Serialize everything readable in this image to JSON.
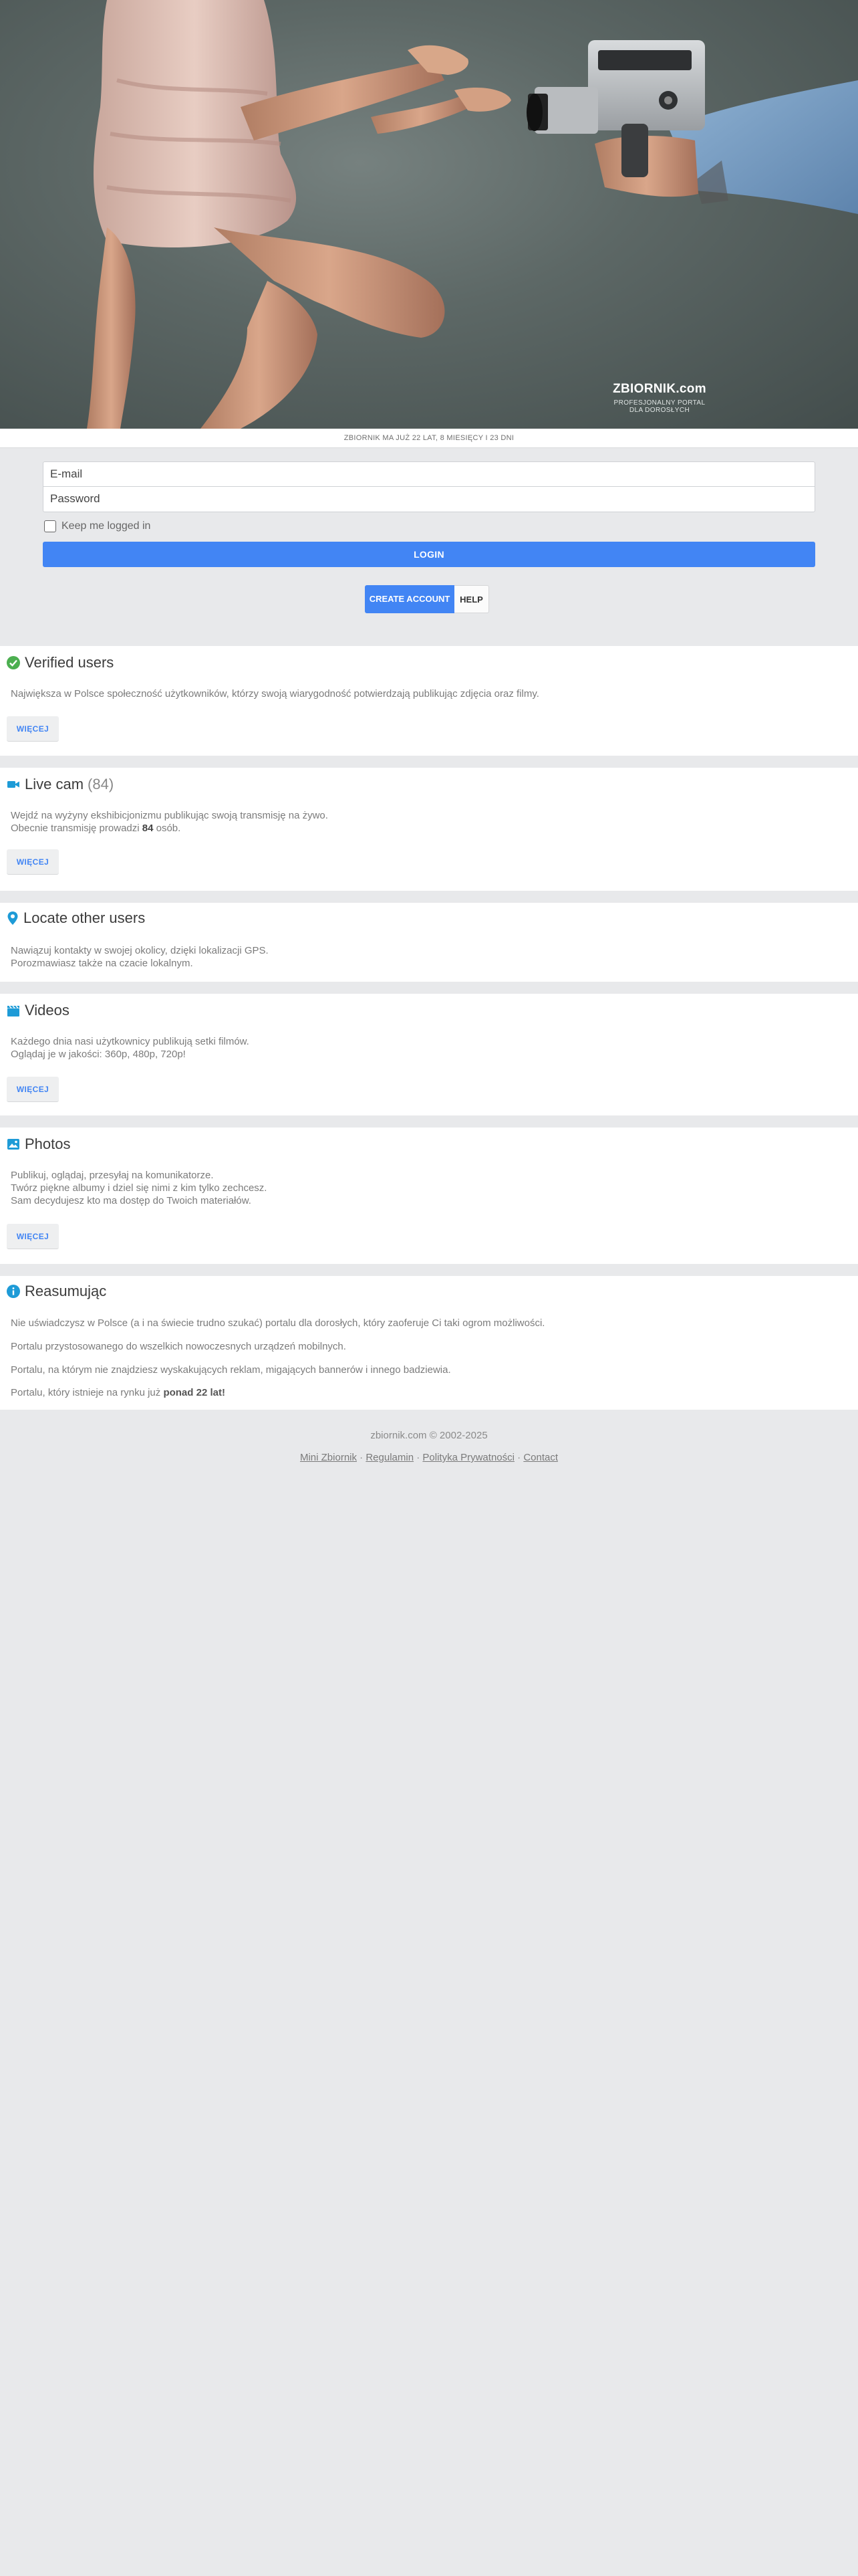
{
  "hero": {
    "brand_name": "ZBIORNIK.com",
    "brand_tagline_1": "PROFESJONALNY PORTAL",
    "brand_tagline_2": "DLA DOROSŁYCH"
  },
  "age_strip": "ZBIORNIK MA JUŻ 22 LAT, 8 MIESIĘCY I 23 DNI",
  "login": {
    "email_placeholder": "E-mail",
    "password_placeholder": "Password",
    "keep_logged_label": "Keep me logged in",
    "login_label": "LOGIN",
    "create_account_label": "CREATE ACCOUNT",
    "help_label": "HELP"
  },
  "sections": {
    "verified": {
      "title": "Verified users",
      "text": "Największa w Polsce społeczność użytkowników, którzy swoją wiarygodność potwierdzają publikując zdjęcia oraz filmy.",
      "more": "WIĘCEJ"
    },
    "livecam": {
      "title": "Live cam",
      "count": "(84)",
      "line1": "Wejdź na wyżyny ekshibicjonizmu publikując swoją transmisję na żywo.",
      "line2_pre": "Obecnie transmisję prowadzi ",
      "line2_num": "84",
      "line2_post": " osób.",
      "more": "WIĘCEJ"
    },
    "locate": {
      "title": "Locate other users",
      "line1": "Nawiązuj kontakty w swojej okolicy, dzięki lokalizacji GPS.",
      "line2": "Porozmawiasz także na czacie lokalnym."
    },
    "videos": {
      "title": "Videos",
      "line1": "Każdego dnia nasi użytkownicy publikują setki filmów.",
      "line2": "Oglądaj je w jakości: 360p, 480p, 720p!",
      "more": "WIĘCEJ"
    },
    "photos": {
      "title": "Photos",
      "line1": "Publikuj, oglądaj, przesyłaj na komunikatorze.",
      "line2": "Twórz piękne albumy i dziel się nimi z kim tylko zechcesz.",
      "line3": "Sam decydujesz kto ma dostęp do Twoich materiałów.",
      "more": "WIĘCEJ"
    },
    "summary": {
      "title": "Reasumując",
      "line1": "Nie uświadczysz w Polsce (a i na świecie trudno szukać) portalu dla dorosłych, który zaoferuje Ci taki ogrom możliwości.",
      "line2": "Portalu przystosowanego do wszelkich nowoczesnych urządzeń mobilnych.",
      "line3": "Portalu, na którym nie znajdziesz wyskakujących reklam, migających bannerów i innego badziewia.",
      "line4_pre": "Portalu, który istnieje na rynku już ",
      "line4_bold": "ponad 22 lat!"
    }
  },
  "footer": {
    "copyright": "zbiornik.com © 2002-2025",
    "link_mini": "Mini Zbiornik",
    "link_regulamin": "Regulamin",
    "link_privacy": "Polityka Prywatności",
    "link_contact": "Contact",
    "separator": "·"
  },
  "colors": {
    "accent": "#4285f4",
    "verified_icon": "#4caf50",
    "section_icon": "#1e9bd7"
  }
}
